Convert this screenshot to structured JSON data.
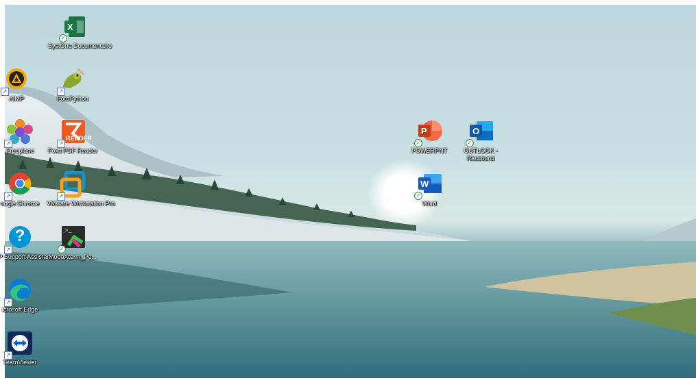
{
  "desktop": {
    "icons": [
      {
        "label": "SystOne Documentaire",
        "icon": "excel-icon"
      },
      {
        "label": "AIMP",
        "icon": "aimp-icon"
      },
      {
        "label": "FotoPython",
        "icon": "python-icon"
      },
      {
        "label": "Freeplane",
        "icon": "freeplane-icon"
      },
      {
        "label": "Foxit PDF Reader",
        "icon": "foxit-pdf-icon"
      },
      {
        "label": "oogle Chrome",
        "icon": "chrome-icon"
      },
      {
        "label": "VMware Workstation Pro",
        "icon": "vmware-icon"
      },
      {
        "label": "HP Support Assistant",
        "icon": "hp-support-icon"
      },
      {
        "label": "MobaXterm_Pe...",
        "icon": "mobaxterm-icon"
      },
      {
        "label": "icrosoft Edge",
        "icon": "edge-icon"
      },
      {
        "label": "TeamViewer",
        "icon": "teamviewer-icon"
      },
      {
        "label": "POWERPNT",
        "icon": "powerpoint-icon"
      },
      {
        "label": "OUTLOOK - Raccourci",
        "icon": "outlook-icon"
      },
      {
        "label": "Word",
        "icon": "word-icon"
      }
    ],
    "glyph_letters": {
      "excel": "X",
      "powerpoint": "P",
      "outlook": "O",
      "word": "W",
      "foxit": "READER",
      "hp": "?",
      "mobaxterm": ">_"
    },
    "overlay_marks": {
      "cloud_synced": "✓",
      "shortcut": "↗"
    },
    "colors": {
      "excel": "#1d7044",
      "powerpoint": "#c43e1c",
      "outlook": "#0f6cbd",
      "word": "#185abd",
      "foxit": "#f05a22",
      "chrome_red": "#db4437",
      "edge": "#0c7bd2",
      "teamviewer": "#0e2a5a",
      "hp": "#0096d6"
    }
  }
}
